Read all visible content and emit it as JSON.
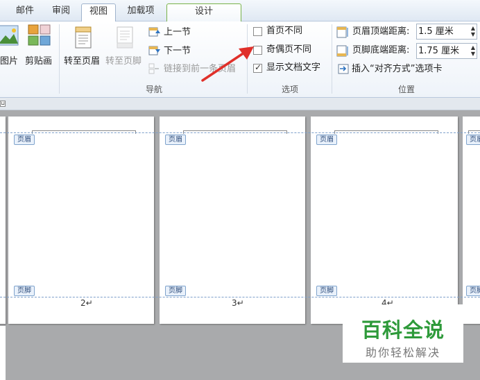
{
  "tabs": [
    {
      "label": "邮件"
    },
    {
      "label": "审阅"
    },
    {
      "label": "视图"
    },
    {
      "label": "加载项"
    },
    {
      "label": "设计"
    }
  ],
  "ribbon": {
    "insert": {
      "picture_label": "图片",
      "clipart_label": "剪贴画"
    },
    "navigation": {
      "goto_header_label": "转至页眉",
      "goto_footer_label": "转至页脚",
      "prev_section_label": "上一节",
      "next_section_label": "下一节",
      "link_prev_label": "链接到前一条页眉",
      "group_label": "导航"
    },
    "options": {
      "diff_first_label": "首页不同",
      "diff_first_checked": false,
      "diff_odd_even_label": "奇偶页不同",
      "diff_odd_even_checked": false,
      "show_doc_text_label": "显示文档文字",
      "show_doc_text_checked": true,
      "group_label": "选项"
    },
    "position": {
      "header_top_label": "页眉顶端距离:",
      "header_top_value": "1.5 厘米",
      "footer_bottom_label": "页脚底端距离:",
      "footer_bottom_value": "1.75 厘米",
      "insert_align_tab_label": "插入“对齐方式”选项卡",
      "group_label": "位置"
    }
  },
  "pages": [
    {
      "header_tag": "页眉",
      "footer_tag": "页脚",
      "number": "2↵"
    },
    {
      "header_tag": "页眉",
      "footer_tag": "页脚",
      "number": "3↵"
    },
    {
      "header_tag": "页眉",
      "footer_tag": "页脚",
      "number": "4↵"
    },
    {
      "header_tag": "页眉",
      "footer_tag": "页脚",
      "number": ""
    }
  ],
  "watermark": {
    "title": "百科全说",
    "subtitle": "助你轻松解决"
  },
  "colors": {
    "accent_green": "#78b248",
    "arrow_red": "#e0302a",
    "watermark_green": "#2e9a3a"
  }
}
